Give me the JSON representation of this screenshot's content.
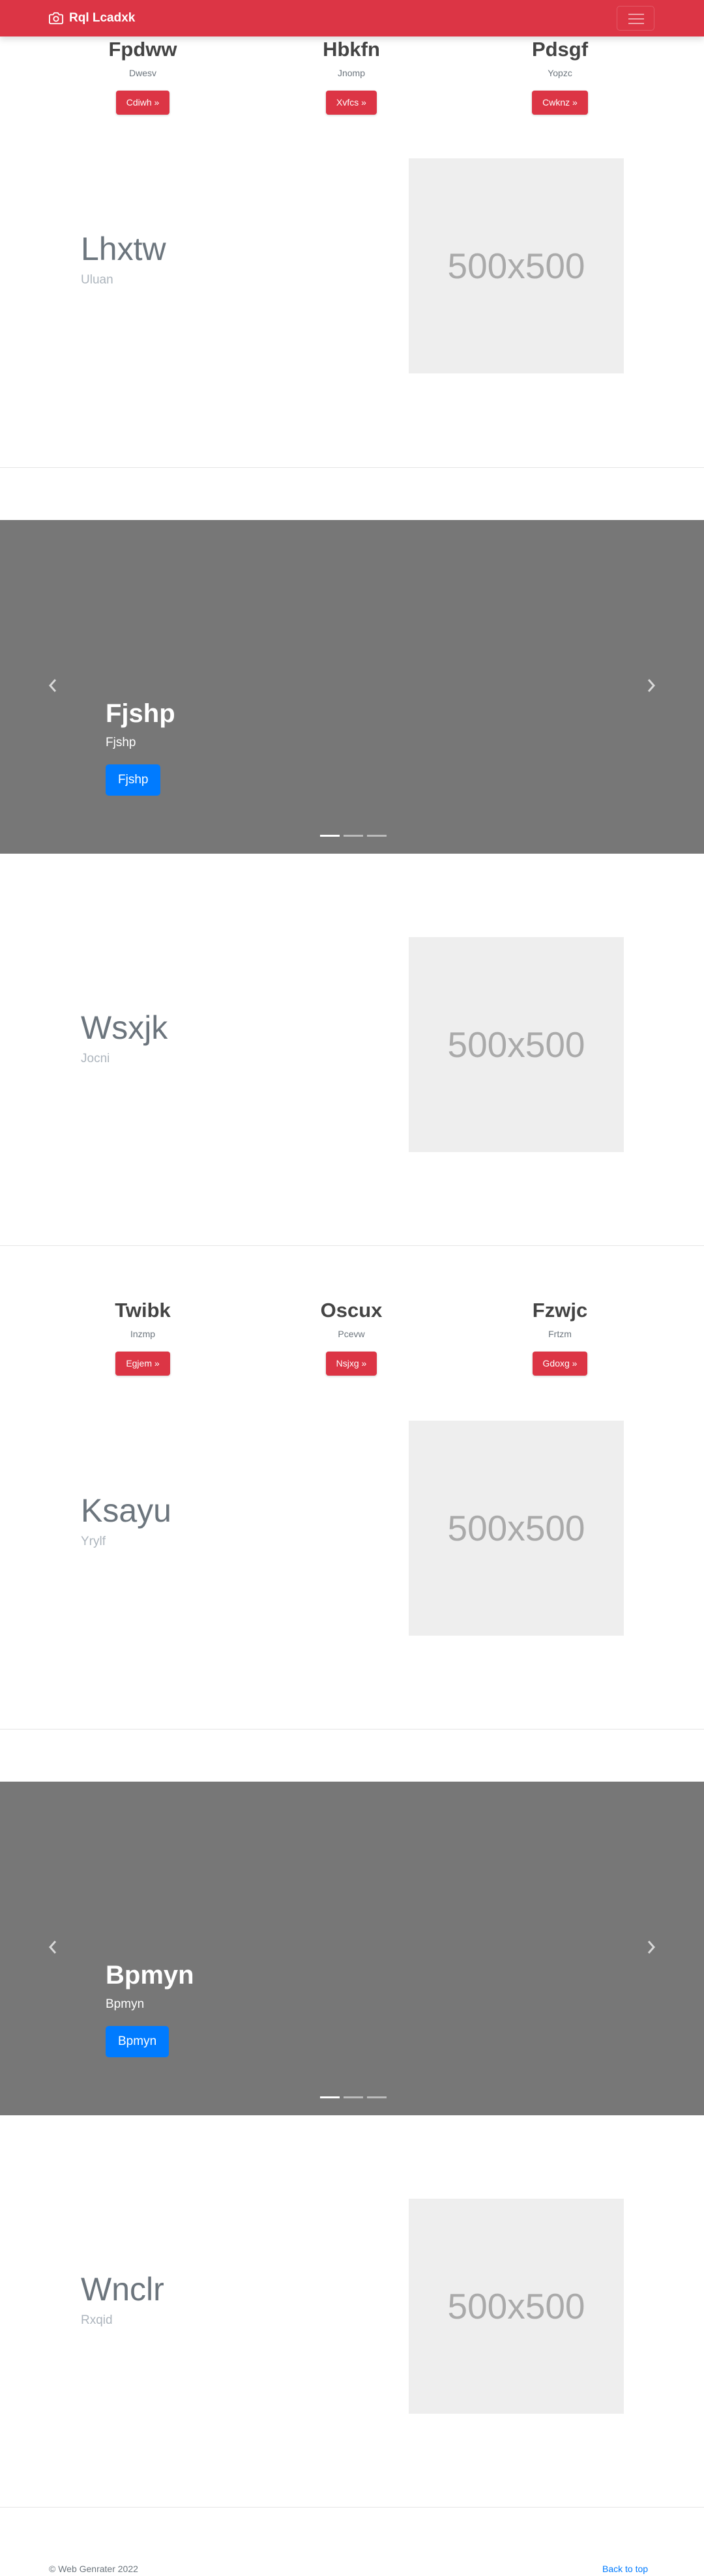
{
  "navbar": {
    "brand": "Rql Lcadxk",
    "brand_color": "#dc3545"
  },
  "icons": {
    "brand": "camera-icon",
    "menu": "hamburger-menu-icon",
    "prev": "chevron-left-icon",
    "next": "chevron-right-icon"
  },
  "section1": {
    "columns": [
      {
        "title": "Fpdww",
        "text": "Dwesv",
        "button": "Cdiwh »"
      },
      {
        "title": "Hbkfn",
        "text": "Jnomp",
        "button": "Xvfcs »"
      },
      {
        "title": "Pdsgf",
        "text": "Yopzc",
        "button": "Cwknz »"
      }
    ]
  },
  "feature1": {
    "heading": "Lhxtw",
    "text": "Uluan",
    "placeholder": "500x500"
  },
  "carousel1": {
    "title": "Fjshp",
    "subtitle": "Fjshp",
    "button": "Fjshp",
    "active_slide": 1,
    "slides": 3
  },
  "feature2": {
    "heading": "Wsxjk",
    "text": "Jocni",
    "placeholder": "500x500"
  },
  "section2": {
    "columns": [
      {
        "title": "Twibk",
        "text": "Inzmp",
        "button": "Egjem »"
      },
      {
        "title": "Oscux",
        "text": "Pcevw",
        "button": "Nsjxg »"
      },
      {
        "title": "Fzwjc",
        "text": "Frtzm",
        "button": "Gdoxg »"
      }
    ]
  },
  "feature3": {
    "heading": "Ksayu",
    "text": "Yrylf",
    "placeholder": "500x500"
  },
  "carousel2": {
    "title": "Bpmyn",
    "subtitle": "Bpmyn",
    "button": "Bpmyn",
    "active_slide": 1,
    "slides": 3
  },
  "feature4": {
    "heading": "Wnclr",
    "text": "Rxqid",
    "placeholder": "500x500"
  },
  "footer": {
    "copyright": "© Web Genrater 2022",
    "back_to_top": "Back to top"
  }
}
